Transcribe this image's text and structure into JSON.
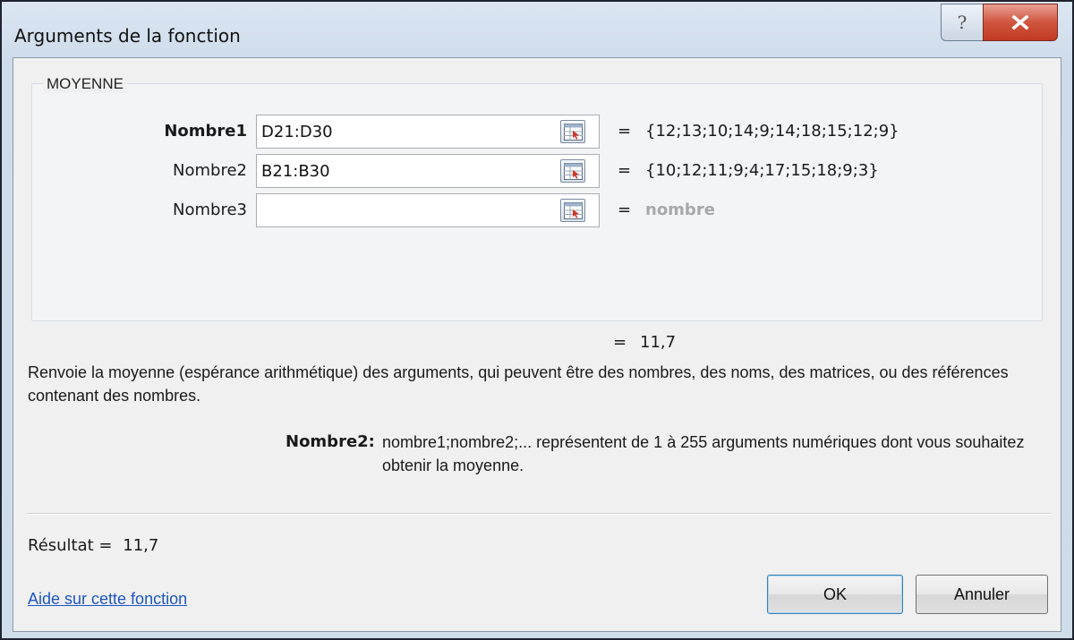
{
  "window": {
    "title": "Arguments de la fonction",
    "help_symbol": "?",
    "close_label": "X"
  },
  "function": {
    "name": "MOYENNE",
    "arguments": [
      {
        "label": "Nombre1",
        "value": "D21:D30",
        "result": "{12;13;10;14;9;14;18;15;12;9}"
      },
      {
        "label": "Nombre2",
        "value": "B21:B30",
        "result": "{10;12;11;9;4;17;15;18;9;3}"
      },
      {
        "label": "Nombre3",
        "value": "",
        "result": "nombre"
      }
    ],
    "equals": "=",
    "total_result": "11,7",
    "description": "Renvoie la moyenne (espérance arithmétique) des arguments, qui peuvent être des nombres, des noms, des matrices, ou des références contenant des nombres.",
    "arg_help_name": "Nombre2:",
    "arg_help_text": "nombre1;nombre2;... représentent de 1 à 255 arguments numériques dont vous souhaitez obtenir la moyenne."
  },
  "footer": {
    "result_label": "Résultat =",
    "result_value": "11,7",
    "help_link": "Aide sur cette fonction",
    "ok_label": "OK",
    "cancel_label": "Annuler"
  }
}
